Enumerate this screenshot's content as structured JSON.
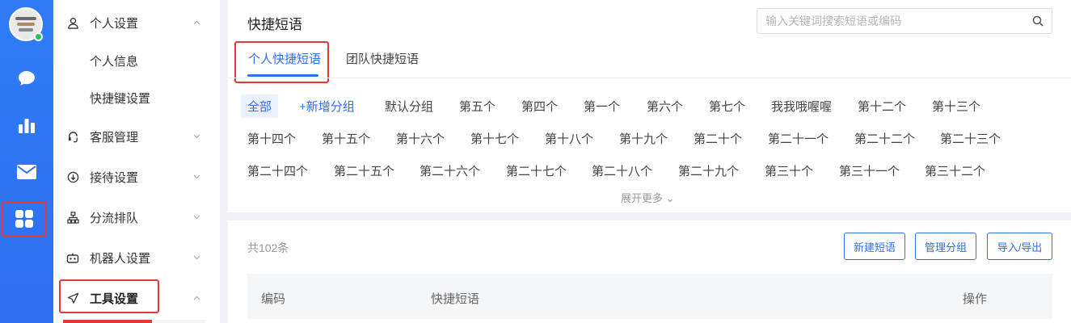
{
  "rail": {
    "icons": [
      "avatar",
      "chat-icon",
      "bar-chart-icon",
      "mail-icon",
      "apps-grid-icon"
    ],
    "accent": "#2f6ff0"
  },
  "sidebar": {
    "items": [
      {
        "label": "个人设置",
        "icon": "user-icon",
        "expanded": true
      },
      {
        "label": "个人信息",
        "child": true
      },
      {
        "label": "快捷键设置",
        "child": true
      },
      {
        "label": "客服管理",
        "icon": "headset-icon",
        "expanded": false
      },
      {
        "label": "接待设置",
        "icon": "download-circle-icon",
        "expanded": false
      },
      {
        "label": "分流排队",
        "icon": "hierarchy-icon",
        "expanded": false
      },
      {
        "label": "机器人设置",
        "icon": "robot-icon",
        "expanded": false
      },
      {
        "label": "工具设置",
        "icon": "send-icon",
        "expanded": true
      }
    ]
  },
  "header": {
    "title": "快捷短语",
    "search_placeholder": "输入关键词搜索短语或编码"
  },
  "tabs": [
    {
      "label": "个人快捷短语",
      "active": true
    },
    {
      "label": "团队快捷短语",
      "active": false
    }
  ],
  "groups": {
    "all_label": "全部",
    "add_label": "+新增分组",
    "row1": [
      "默认分组",
      "第五个",
      "第四个",
      "第一个",
      "第六个",
      "第七个",
      "我我哦喔喔",
      "第十二个",
      "第十三个"
    ],
    "row2": [
      "第十四个",
      "第十五个",
      "第十六个",
      "第十七个",
      "第十八个",
      "第十九个",
      "第二十个",
      "第二十一个",
      "第二十二个",
      "第二十三个"
    ],
    "row3": [
      "第二十四个",
      "第二十五个",
      "第二十六个",
      "第二十七个",
      "第二十八个",
      "第二十九个",
      "第三十个",
      "第三十一个",
      "第三十二个"
    ],
    "expand_label": "展开更多 ⌄"
  },
  "list": {
    "total_label": "共102条",
    "buttons": [
      "新建短语",
      "管理分组",
      "导入/导出"
    ],
    "columns": [
      "编码",
      "快捷短语",
      "操作"
    ]
  }
}
